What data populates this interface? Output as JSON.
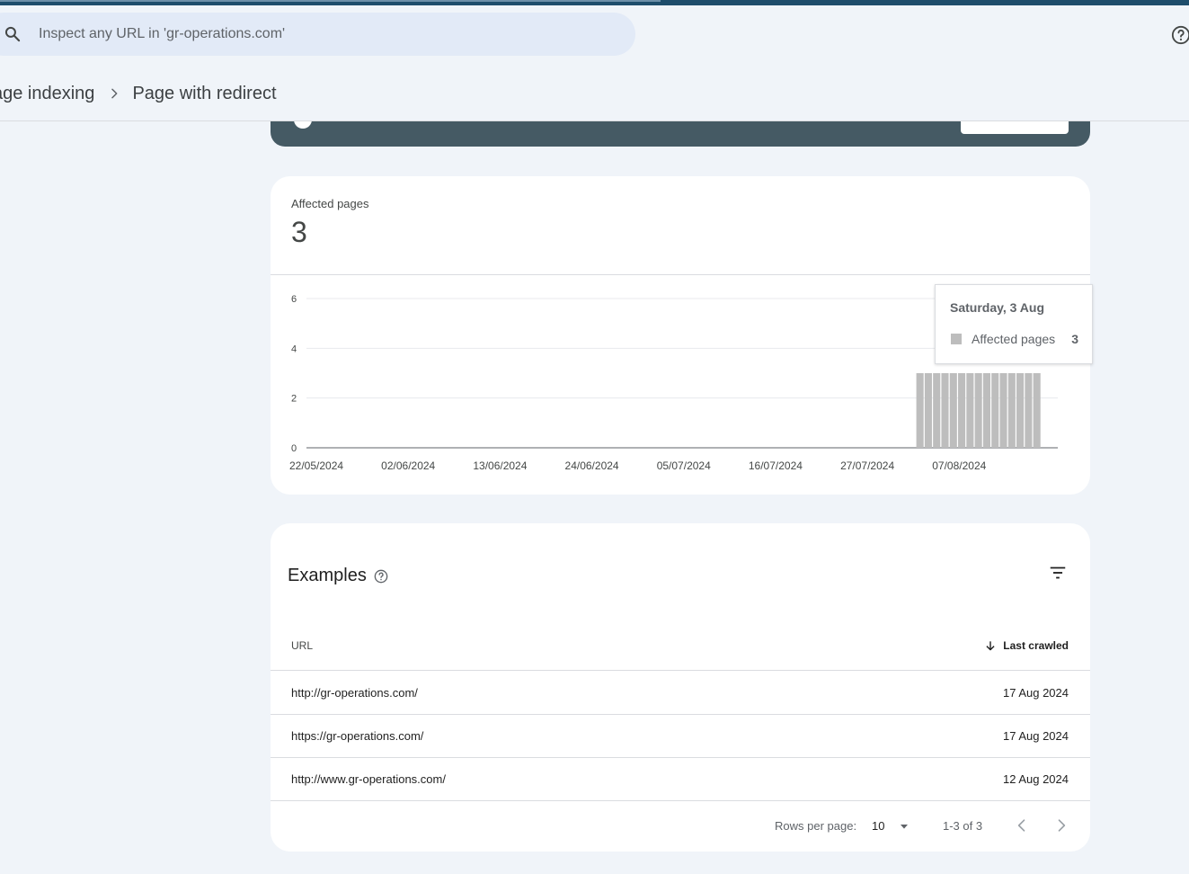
{
  "search": {
    "placeholder": "Inspect any URL in 'gr-operations.com'"
  },
  "breadcrumb": {
    "parent": "age indexing",
    "current": "Page with redirect"
  },
  "summary": {
    "label": "Affected pages",
    "value": "3"
  },
  "chart_data": {
    "type": "bar",
    "x_tick_labels": [
      "22/05/2024",
      "02/06/2024",
      "13/06/2024",
      "24/06/2024",
      "05/07/2024",
      "16/07/2024",
      "27/07/2024",
      "07/08/2024"
    ],
    "y_ticks": [
      0,
      2,
      4,
      6
    ],
    "ylim": [
      0,
      6
    ],
    "grid": true,
    "x_start": "2024-05-22",
    "x_end": "2024-08-19",
    "series": [
      {
        "name": "Affected pages",
        "color": "#bdbdbd",
        "points": [
          {
            "date": "2024-08-03",
            "value": 3
          },
          {
            "date": "2024-08-04",
            "value": 3
          },
          {
            "date": "2024-08-05",
            "value": 3
          },
          {
            "date": "2024-08-06",
            "value": 3
          },
          {
            "date": "2024-08-07",
            "value": 3
          },
          {
            "date": "2024-08-08",
            "value": 3
          },
          {
            "date": "2024-08-09",
            "value": 3
          },
          {
            "date": "2024-08-10",
            "value": 3
          },
          {
            "date": "2024-08-11",
            "value": 3
          },
          {
            "date": "2024-08-12",
            "value": 3
          },
          {
            "date": "2024-08-13",
            "value": 3
          },
          {
            "date": "2024-08-14",
            "value": 3
          },
          {
            "date": "2024-08-15",
            "value": 3
          },
          {
            "date": "2024-08-16",
            "value": 3
          },
          {
            "date": "2024-08-17",
            "value": 3
          }
        ]
      }
    ],
    "tooltip": {
      "title": "Saturday, 3 Aug",
      "series_label": "Affected pages",
      "value": "3"
    }
  },
  "examples": {
    "title": "Examples",
    "columns": {
      "url": "URL",
      "last_crawled": "Last crawled"
    },
    "rows": [
      {
        "url": "http://gr-operations.com/",
        "date": "17 Aug 2024"
      },
      {
        "url": "https://gr-operations.com/",
        "date": "17 Aug 2024"
      },
      {
        "url": "http://www.gr-operations.com/",
        "date": "12 Aug 2024"
      }
    ],
    "pager": {
      "rows_label": "Rows per page:",
      "rows_value": "10",
      "range": "1-3 of 3"
    }
  },
  "icons": {
    "search": "search-icon",
    "help": "help-circle-icon",
    "breadcrumb_separator": "chevron-right-icon",
    "filter": "filter-icon",
    "sort": "arrow-down-icon",
    "dropdown": "caret-down-icon",
    "prev": "chevron-left-icon",
    "next": "chevron-right-icon"
  },
  "colors": {
    "accent_bar": "#1e4d6b",
    "banner": "#455a64",
    "background": "#f0f4f9"
  }
}
